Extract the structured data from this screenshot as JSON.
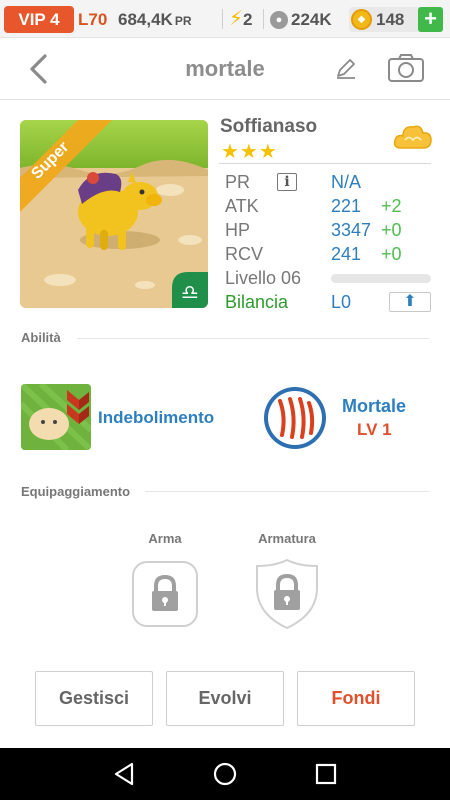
{
  "status": {
    "vip": "VIP 4",
    "level": "L70",
    "power": "684,4K",
    "power_unit": "PR",
    "energy": "2",
    "paws": "224K",
    "coins": "148",
    "add": "+"
  },
  "nav": {
    "title": "mortale"
  },
  "pet": {
    "name": "Soffianaso",
    "stars": "★★★",
    "rarity": "Super",
    "stats": [
      {
        "key": "PR",
        "value": "N/A",
        "delta": ""
      },
      {
        "key": "ATK",
        "value": "221",
        "delta": "+2"
      },
      {
        "key": "HP",
        "value": "3347",
        "delta": "+0"
      },
      {
        "key": "RCV",
        "value": "241",
        "delta": "+0"
      }
    ],
    "level_label": "Livello 06",
    "level_progress": 0,
    "balance_label": "Bilancia",
    "balance_value": "L0",
    "info_icon": "i"
  },
  "abilities": {
    "title": "Abilità",
    "skill_name": "Indebolimento",
    "mortal_name": "Mortale",
    "mortal_level": "LV 1"
  },
  "equipment": {
    "title": "Equipaggiamento",
    "weapon": "Arma",
    "armor": "Armatura"
  },
  "buttons": {
    "manage": "Gestisci",
    "evolve": "Evolvi",
    "merge": "Fondi"
  },
  "colors": {
    "accent_blue": "#2d7fc0",
    "accent_red": "#e0502a",
    "accent_green": "#4fbe4f",
    "vip_orange": "#e8572c"
  }
}
